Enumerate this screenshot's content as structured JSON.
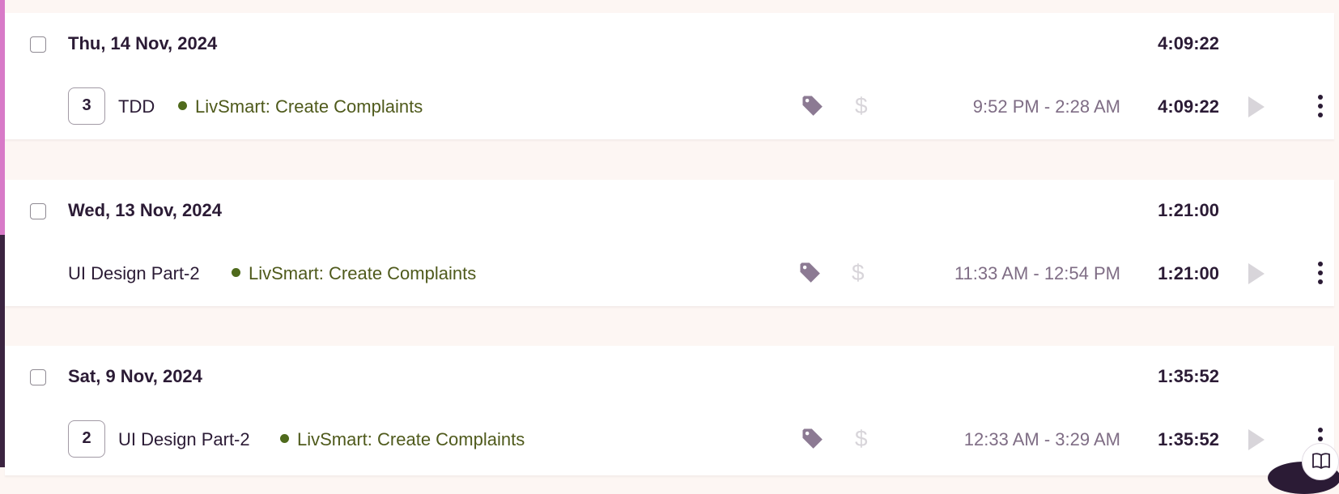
{
  "colors": {
    "project_dot": "#4f6a1c",
    "accent_strip": "#d87ac8",
    "tag_icon": "#8c7a93",
    "dollar_icon": "#d8d5da"
  },
  "groups": [
    {
      "date": "Thu, 14 Nov, 2024",
      "total": "4:09:22",
      "entry": {
        "count": "3",
        "description": "TDD",
        "project": "LivSmart: Create Complaints",
        "time_range": "9:52 PM - 2:28 AM",
        "duration": "4:09:22",
        "billable_symbol": "$"
      }
    },
    {
      "date": "Wed, 13 Nov, 2024",
      "total": "1:21:00",
      "entry": {
        "description": "UI Design Part-2",
        "project": "LivSmart: Create Complaints",
        "time_range": "11:33 AM - 12:54 PM",
        "duration": "1:21:00",
        "billable_symbol": "$"
      }
    },
    {
      "date": "Sat, 9 Nov, 2024",
      "total": "1:35:52",
      "entry": {
        "count": "2",
        "description": "UI Design Part-2",
        "project": "LivSmart: Create Complaints",
        "time_range": "12:33 AM - 3:29 AM",
        "duration": "1:35:52",
        "billable_symbol": "$"
      }
    }
  ]
}
